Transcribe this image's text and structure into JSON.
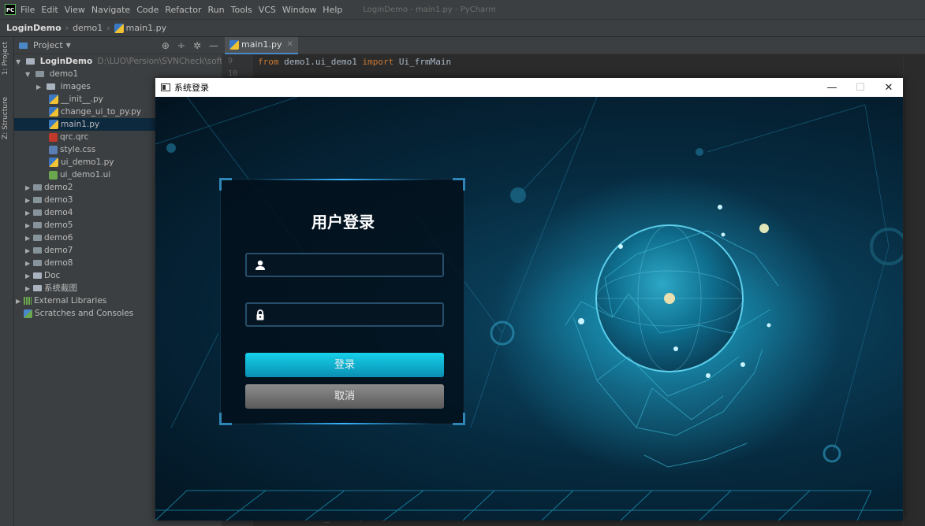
{
  "menubar": {
    "logo": "PC",
    "items": [
      "File",
      "Edit",
      "View",
      "Navigate",
      "Code",
      "Refactor",
      "Run",
      "Tools",
      "VCS",
      "Window",
      "Help"
    ],
    "window_title": "LoginDemo - main1.py - PyCharm"
  },
  "breadcrumb": {
    "project": "LoginDemo",
    "folder": "demo1",
    "file": "main1.py"
  },
  "sidetabs": {
    "project": "1: Project",
    "structure": "Z: Structure"
  },
  "project_panel": {
    "header": "Project",
    "root_name": "LoginDemo",
    "root_path": "D:\\LUO\\Persion\\SVNCheck\\software\\",
    "demo1": "demo1",
    "images": "images",
    "files": [
      "__init__.py",
      "change_ui_to_py.py",
      "main1.py",
      "qrc.qrc",
      "style.css",
      "ui_demo1.py",
      "ui_demo1.ui"
    ],
    "folders": [
      "demo2",
      "demo3",
      "demo4",
      "demo5",
      "demo6",
      "demo7",
      "demo8",
      "Doc",
      "系统截图"
    ],
    "external": "External Libraries",
    "scratches": "Scratches and Consoles"
  },
  "editor": {
    "tab": "main1.py",
    "lines": [
      "9",
      "10"
    ],
    "code_from": "from",
    "code_module": " demo1.ui_demo1 ",
    "code_import": "import",
    "code_name": " Ui_frmMain",
    "faded": "def cancel_button(self):"
  },
  "dialog": {
    "title": "系统登录",
    "heading": "用户登录",
    "login_label": "登录",
    "cancel_label": "取消"
  },
  "colors": {
    "accent": "#16d1ea",
    "selection": "#0d293e",
    "panel": "#3c3f41"
  }
}
